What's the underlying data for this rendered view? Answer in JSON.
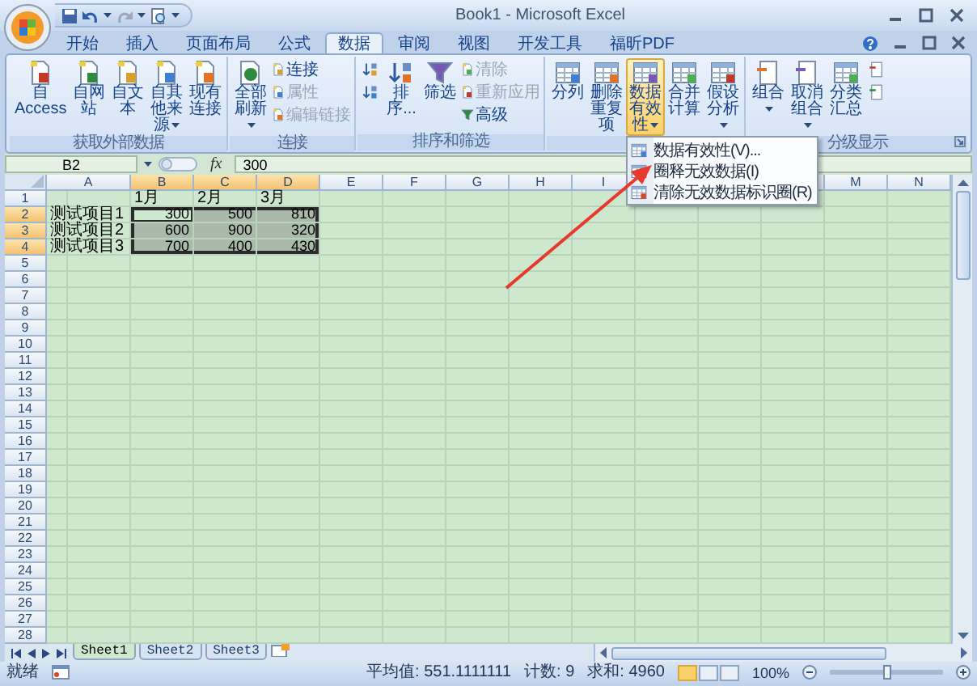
{
  "window": {
    "title": "Book1 - Microsoft Excel"
  },
  "tabs": [
    {
      "label": "开始",
      "selected": false
    },
    {
      "label": "插入",
      "selected": false
    },
    {
      "label": "页面布局",
      "selected": false
    },
    {
      "label": "公式",
      "selected": false
    },
    {
      "label": "数据",
      "selected": true
    },
    {
      "label": "审阅",
      "selected": false
    },
    {
      "label": "视图",
      "selected": false
    },
    {
      "label": "开发工具",
      "selected": false
    },
    {
      "label": "福昕PDF",
      "selected": false
    }
  ],
  "ribbon_groups": [
    {
      "label": "获取外部数据",
      "dialog_launcher": false,
      "buttons": [
        {
          "kind": "large",
          "label": "自 Access",
          "dropdown": false,
          "disabled": false,
          "pressed": false
        },
        {
          "kind": "large",
          "label": "自网站",
          "dropdown": false,
          "disabled": false,
          "pressed": false
        },
        {
          "kind": "large",
          "label": "自文本",
          "dropdown": false,
          "disabled": false,
          "pressed": false
        },
        {
          "kind": "large",
          "label": "自其他来源",
          "dropdown": true,
          "disabled": false,
          "pressed": false
        },
        {
          "kind": "large",
          "label": "现有连接",
          "dropdown": false,
          "disabled": false,
          "pressed": false
        }
      ]
    },
    {
      "label": "连接",
      "dialog_launcher": false,
      "buttons": [
        {
          "kind": "large",
          "label": "全部刷新",
          "dropdown": true,
          "disabled": false,
          "pressed": false
        },
        {
          "kind": "small",
          "label": "连接",
          "dropdown": false,
          "disabled": false,
          "pressed": false
        },
        {
          "kind": "small",
          "label": "属性",
          "dropdown": false,
          "disabled": true,
          "pressed": false
        },
        {
          "kind": "small",
          "label": "编辑链接",
          "dropdown": false,
          "disabled": true,
          "pressed": false
        }
      ]
    },
    {
      "label": "排序和筛选",
      "dialog_launcher": false,
      "buttons": [
        {
          "kind": "icon",
          "dropdown": false,
          "disabled": false,
          "pressed": false
        },
        {
          "kind": "icon",
          "dropdown": false,
          "disabled": false,
          "pressed": false
        },
        {
          "kind": "large",
          "label": "排序...",
          "dropdown": false,
          "disabled": false,
          "pressed": false
        },
        {
          "kind": "large",
          "label": "筛选",
          "dropdown": false,
          "disabled": false,
          "pressed": false
        },
        {
          "kind": "small",
          "label": "清除",
          "dropdown": false,
          "disabled": true,
          "pressed": false
        },
        {
          "kind": "small",
          "label": "重新应用",
          "dropdown": false,
          "disabled": true,
          "pressed": false
        },
        {
          "kind": "small",
          "label": "高级",
          "dropdown": false,
          "disabled": false,
          "pressed": false
        }
      ]
    },
    {
      "dialog_launcher": false,
      "buttons": [
        {
          "kind": "large",
          "label": "分列",
          "dropdown": false,
          "disabled": false,
          "pressed": false
        },
        {
          "kind": "large",
          "label": "删除重复项",
          "dropdown": false,
          "disabled": false,
          "pressed": false
        },
        {
          "kind": "large",
          "label": "数据有效性",
          "dropdown": true,
          "disabled": false,
          "pressed": true
        },
        {
          "kind": "large",
          "label": "合并计算",
          "dropdown": false,
          "disabled": false,
          "pressed": false
        },
        {
          "kind": "large",
          "label": "假设分析",
          "dropdown": true,
          "disabled": false,
          "pressed": false
        }
      ]
    },
    {
      "label": "分级显示",
      "dialog_launcher": true,
      "buttons": [
        {
          "kind": "large",
          "label": "组合",
          "dropdown": true,
          "disabled": false,
          "pressed": false
        },
        {
          "kind": "large",
          "label": "取消组合",
          "dropdown": true,
          "disabled": false,
          "pressed": false
        },
        {
          "kind": "large",
          "label": "分类汇总",
          "dropdown": false,
          "disabled": false,
          "pressed": false
        },
        {
          "kind": "icon",
          "dropdown": false,
          "disabled": false,
          "pressed": false
        },
        {
          "kind": "icon",
          "dropdown": false,
          "disabled": false,
          "pressed": false
        }
      ]
    }
  ],
  "dropdown_menu": {
    "items": [
      {
        "label": "数据有效性(V)..."
      },
      {
        "label": "圈释无效数据(I)"
      },
      {
        "label": "清除无效数据标识圈(R)"
      }
    ]
  },
  "formula_bar": {
    "name_box": "B2",
    "function_label": "fx",
    "value": "300"
  },
  "sheet": {
    "columns": [
      {
        "kind": "letter",
        "letter": "A",
        "selected": false
      },
      {
        "kind": "letter",
        "letter": "B",
        "selected": true
      },
      {
        "kind": "letter",
        "letter": "C",
        "selected": true
      },
      {
        "kind": "letter",
        "letter": "D",
        "selected": true
      },
      {
        "kind": "letter",
        "letter": "E",
        "selected": false
      },
      {
        "kind": "letter",
        "letter": "F",
        "selected": false
      },
      {
        "kind": "letter",
        "letter": "G",
        "selected": false
      },
      {
        "kind": "letter",
        "letter": "H",
        "selected": false
      },
      {
        "kind": "letter",
        "letter": "I",
        "selected": false
      },
      {
        "kind": "covered"
      },
      {
        "kind": "covered"
      },
      {
        "kind": "blank",
        "selected": false
      },
      {
        "kind": "letter",
        "letter": "M",
        "selected": false
      },
      {
        "kind": "letter",
        "letter": "N",
        "selected": false
      }
    ],
    "rows": [
      {
        "number": "1",
        "selected": false,
        "cells": [
          {
            "kind": "empty"
          },
          {
            "kind": "text",
            "text": "1月",
            "active": false
          },
          {
            "kind": "text",
            "text": "2月",
            "active": false
          },
          {
            "kind": "text",
            "text": "3月",
            "active": false
          }
        ]
      },
      {
        "number": "2",
        "selected": true,
        "cells": [
          {
            "kind": "text",
            "text": "测试项目1",
            "active": false
          },
          {
            "kind": "number",
            "text": "300",
            "active": true
          },
          {
            "kind": "number",
            "text": "500",
            "active": false
          },
          {
            "kind": "number",
            "text": "810",
            "active": false
          }
        ]
      },
      {
        "number": "3",
        "selected": true,
        "cells": [
          {
            "kind": "text",
            "text": "测试项目2",
            "active": false
          },
          {
            "kind": "number",
            "text": "600",
            "active": false
          },
          {
            "kind": "number",
            "text": "900",
            "active": false
          },
          {
            "kind": "number",
            "text": "320",
            "active": false
          }
        ]
      },
      {
        "number": "4",
        "selected": true,
        "cells": [
          {
            "kind": "text",
            "text": "测试项目3",
            "active": false
          },
          {
            "kind": "number",
            "text": "700",
            "active": false
          },
          {
            "kind": "number",
            "text": "400",
            "active": false
          },
          {
            "kind": "number",
            "text": "430",
            "active": false
          }
        ]
      },
      {
        "number": "5",
        "selected": false
      },
      {
        "number": "6",
        "selected": false
      },
      {
        "number": "7",
        "selected": false
      },
      {
        "number": "8",
        "selected": false
      },
      {
        "number": "9",
        "selected": false
      },
      {
        "number": "10",
        "selected": false
      },
      {
        "number": "11",
        "selected": false
      },
      {
        "number": "12",
        "selected": false
      },
      {
        "number": "13",
        "selected": false
      },
      {
        "number": "14",
        "selected": false
      },
      {
        "number": "15",
        "selected": false
      },
      {
        "number": "16",
        "selected": false
      },
      {
        "number": "17",
        "selected": false
      },
      {
        "number": "18",
        "selected": false
      },
      {
        "number": "19",
        "selected": false
      },
      {
        "number": "20",
        "selected": false
      },
      {
        "number": "21",
        "selected": false
      },
      {
        "number": "22",
        "selected": false
      },
      {
        "number": "23",
        "selected": false
      },
      {
        "number": "24",
        "selected": false
      },
      {
        "number": "25",
        "selected": false
      },
      {
        "number": "26",
        "selected": false
      },
      {
        "number": "27",
        "selected": false
      },
      {
        "number": "28",
        "selected": false
      }
    ]
  },
  "sheet_tabs": [
    {
      "label": "Sheet1",
      "selected": true
    },
    {
      "label": "Sheet2",
      "selected": false
    },
    {
      "label": "Sheet3",
      "selected": false
    }
  ],
  "status_bar": {
    "mode": "就绪",
    "average": "平均值: 551.1111111",
    "count": "计数: 9",
    "sum": "求和: 4960",
    "views": [
      {
        "selected": true
      },
      {
        "selected": false
      },
      {
        "selected": false
      }
    ],
    "zoom": "100%",
    "zoom_slider": {
      "level": 0.5
    }
  }
}
